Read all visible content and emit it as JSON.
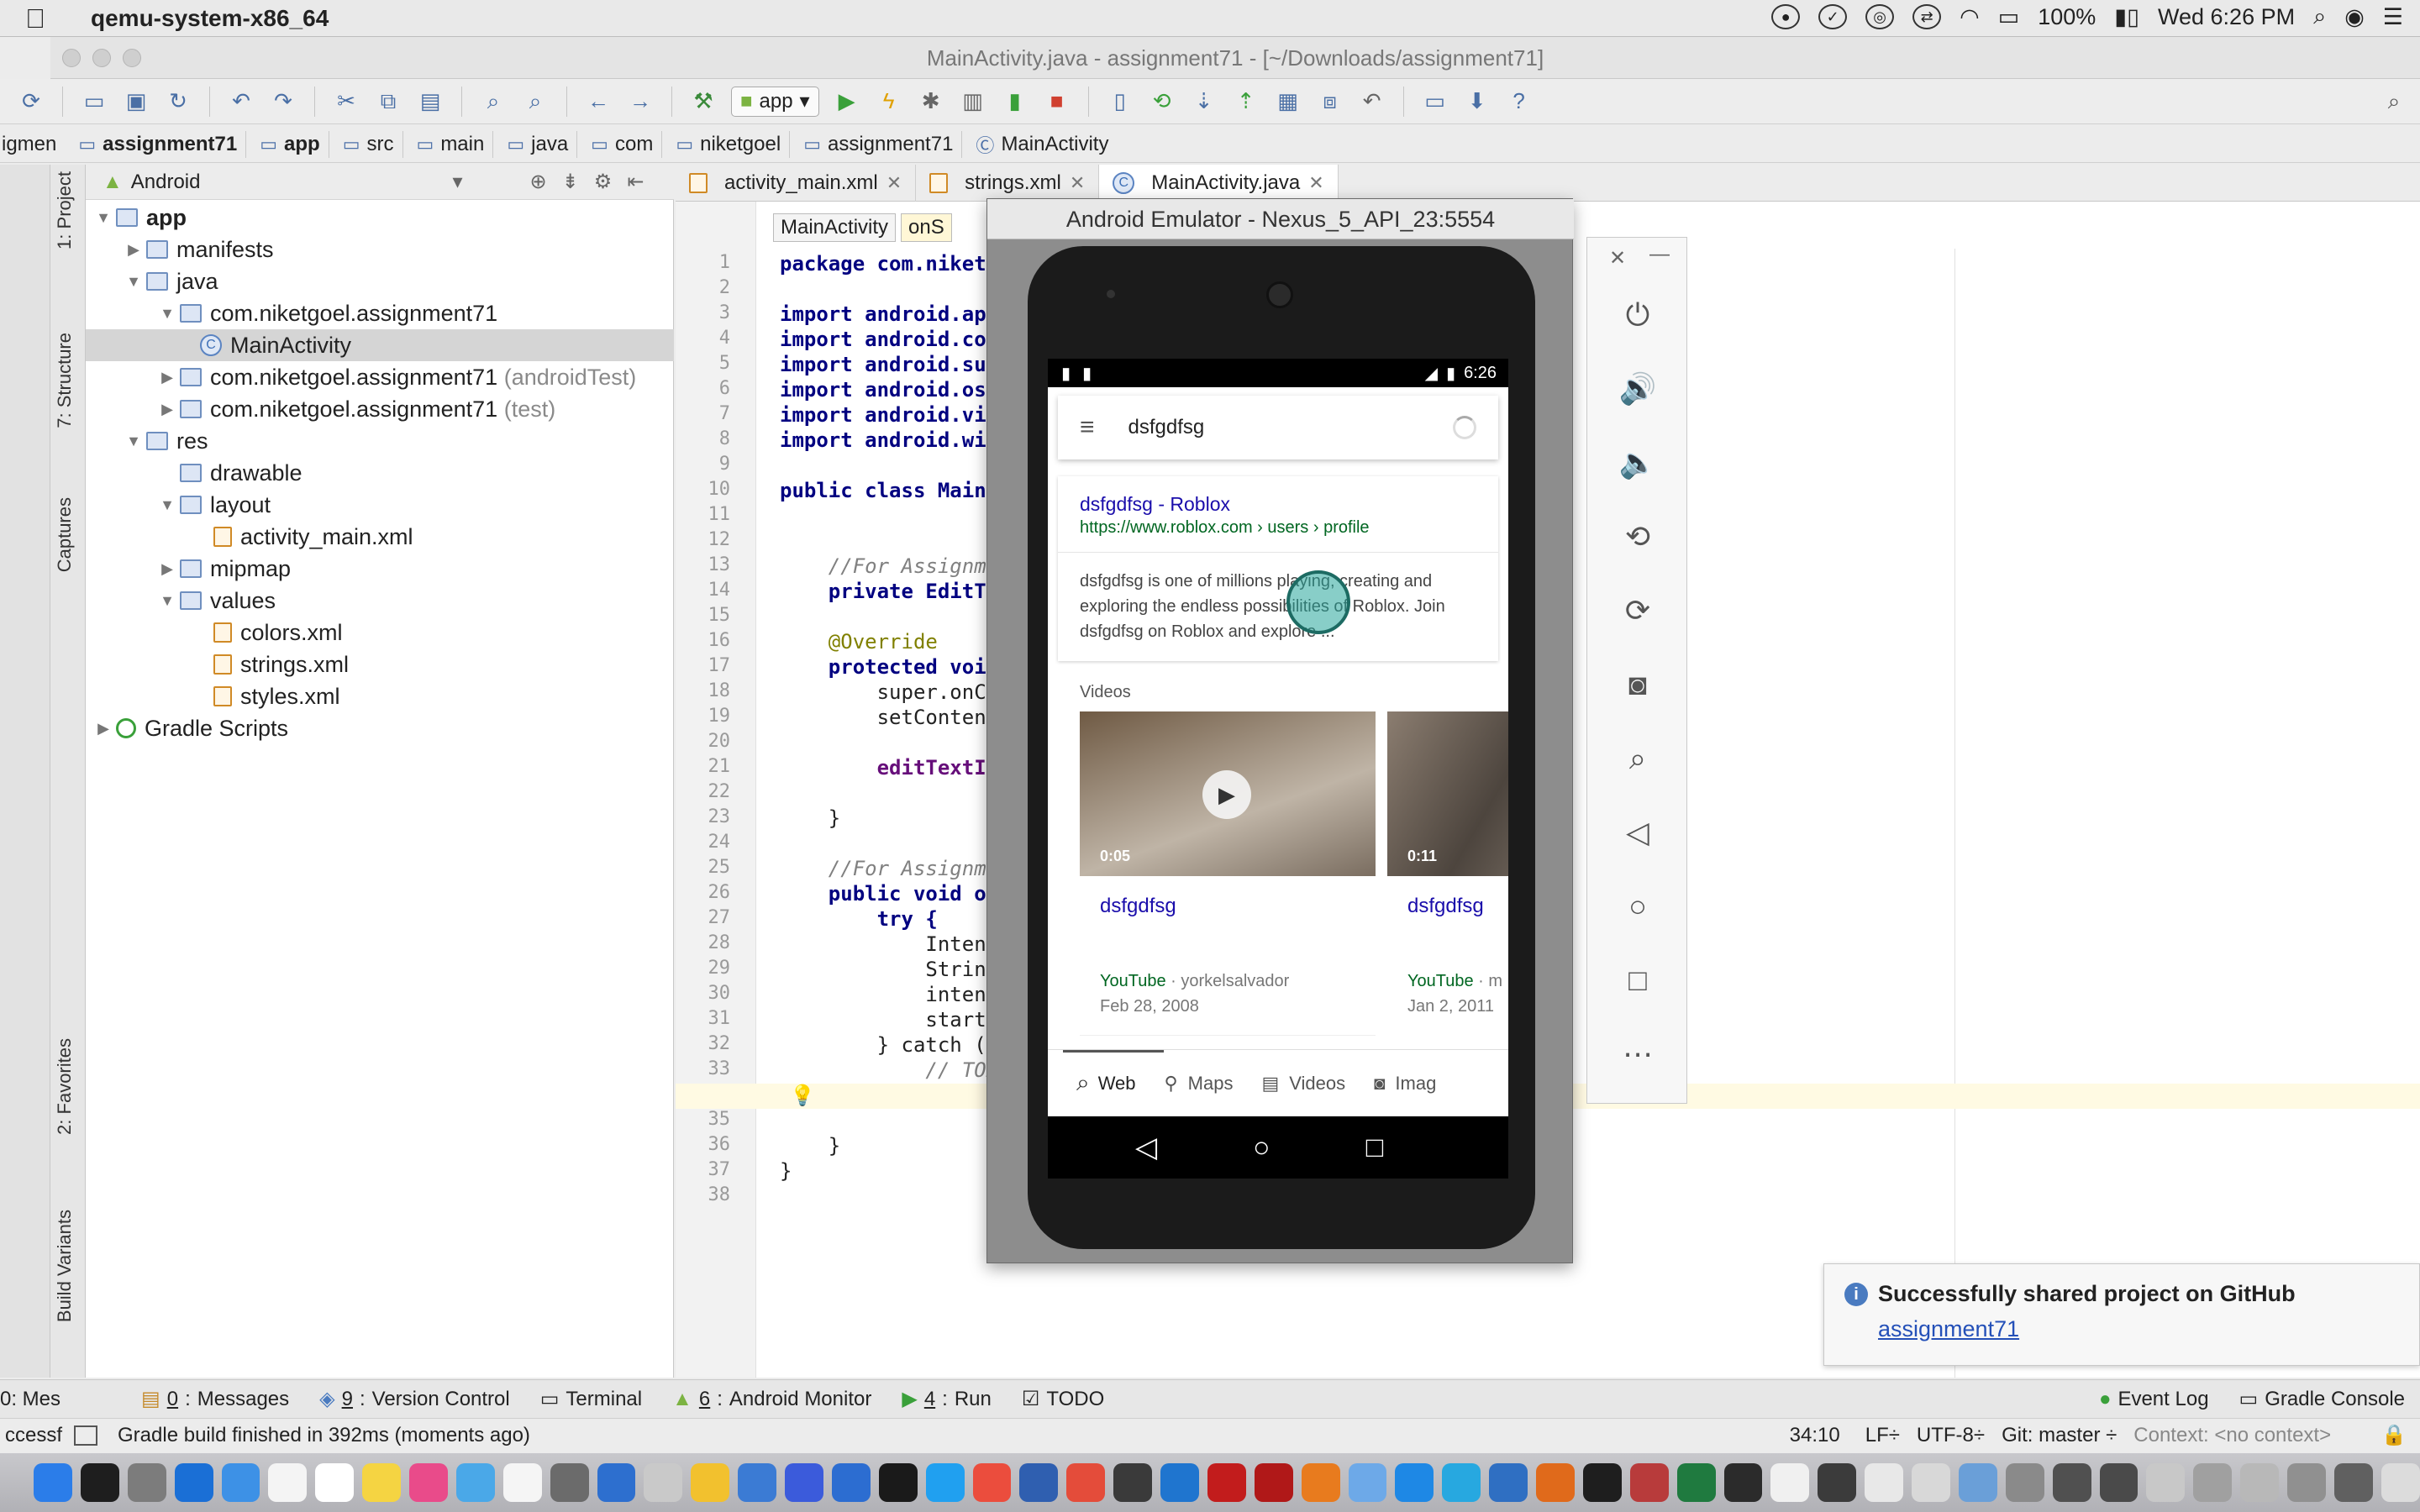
{
  "menubar": {
    "app_name": "qemu-system-x86_64",
    "battery": "100%",
    "clock": "Wed 6:26 PM"
  },
  "window": {
    "title": "MainActivity.java - assignment71 - [~/Downloads/assignment71]"
  },
  "toolbar": {
    "run_config": "app"
  },
  "breadcrumbs": [
    "assignment71",
    "app",
    "src",
    "main",
    "java",
    "com",
    "niketgoel",
    "assignment71",
    "MainActivity"
  ],
  "left_tabs": [
    "1: Project",
    "7: Structure",
    "Captures",
    "2: Favorites",
    "Build Variants"
  ],
  "project_panel": {
    "view_mode": "Android",
    "tree": [
      {
        "label": "app",
        "bold": true
      },
      {
        "label": "manifests"
      },
      {
        "label": "java"
      },
      {
        "label": "com.niketgoel.assignment71"
      },
      {
        "label": "MainActivity"
      },
      {
        "label": "com.niketgoel.assignment71",
        "suffix": "(androidTest)"
      },
      {
        "label": "com.niketgoel.assignment71",
        "suffix": "(test)"
      },
      {
        "label": "res"
      },
      {
        "label": "drawable"
      },
      {
        "label": "layout"
      },
      {
        "label": "activity_main.xml"
      },
      {
        "label": "mipmap"
      },
      {
        "label": "values"
      },
      {
        "label": "colors.xml"
      },
      {
        "label": "strings.xml"
      },
      {
        "label": "styles.xml"
      },
      {
        "label": "Gradle Scripts"
      }
    ]
  },
  "editor": {
    "tabs": [
      "activity_main.xml",
      "strings.xml",
      "MainActivity.java"
    ],
    "nav_class": "MainActivity",
    "nav_method": "onS",
    "line_numbers": [
      "1",
      "2",
      "3",
      "4",
      "5",
      "6",
      "7",
      "8",
      "9",
      "10",
      "11",
      "12",
      "13",
      "14",
      "15",
      "16",
      "17",
      "18",
      "19",
      "20",
      "21",
      "22",
      "23",
      "24",
      "25",
      "26",
      "27",
      "28",
      "29",
      "30",
      "31",
      "32",
      "33",
      "34",
      "35",
      "36",
      "37",
      "38"
    ],
    "code_lines": [
      "package com.niketg",
      "",
      "import android.app",
      "import android.con",
      "import android.sup",
      "import android.os.",
      "import android.vie",
      "import android.wid",
      "",
      "public class MainA",
      "",
      "",
      "    //For Assignme",
      "    private EditTe",
      "",
      "    @Override",
      "    protected void",
      "        super.onCr",
      "        setContent",
      "",
      "        editTextIn",
      "",
      "    }",
      "",
      "    //For Assignme",
      "    public void on",
      "        try {",
      "            Intent",
      "            String",
      "            intent",
      "            startA",
      "        } catch (E",
      "            // TOD",
      "        }",
      "",
      "    }",
      "}",
      ""
    ]
  },
  "emulator": {
    "title": "Android Emulator - Nexus_5_API_23:5554",
    "status_time": "6:26",
    "search_query": "dsfgdfsg",
    "result": {
      "title": "dsfgdfsg - Roblox",
      "url": "https://www.roblox.com › users › profile",
      "snippet": "dsfgdfsg is one of millions playing, creating and exploring the endless possibilities of Roblox. Join dsfgdfsg on Roblox and explore  ..."
    },
    "videos_heading": "Videos",
    "videos": [
      {
        "duration": "0:05",
        "title": "dsfgdfsg",
        "source": "YouTube",
        "channel": "· yorkelsalvador",
        "date": "Feb 28, 2008"
      },
      {
        "duration": "0:11",
        "title": "dsfgdfsg",
        "source": "YouTube",
        "channel": "· m",
        "date": "Jan 2, 2011"
      }
    ],
    "bottom_nav": [
      "Web",
      "Maps",
      "Videos",
      "Imag"
    ]
  },
  "notification": {
    "title": "Successfully shared project on GitHub",
    "link": "assignment71"
  },
  "bottom_tabs": [
    {
      "num": "0",
      "label": "Messages"
    },
    {
      "num": "9",
      "label": "Version Control"
    },
    {
      "num": "",
      "label": "Terminal"
    },
    {
      "num": "6",
      "label": "Android Monitor"
    },
    {
      "num": "4",
      "label": "Run"
    },
    {
      "num": "",
      "label": "TODO"
    }
  ],
  "bottom_right_tabs": [
    "Event Log",
    "Gradle Console"
  ],
  "status": {
    "message": "Gradle build finished in 392ms (moments ago)",
    "position": "34:10",
    "line_sep": "LF÷",
    "encoding": "UTF-8÷",
    "git": "Git: master ÷",
    "context": "Context: <no context>"
  },
  "colors": {
    "accent_blue": "#1a0dab",
    "url_green": "#006621",
    "emulator_teal": "#26a69a"
  }
}
